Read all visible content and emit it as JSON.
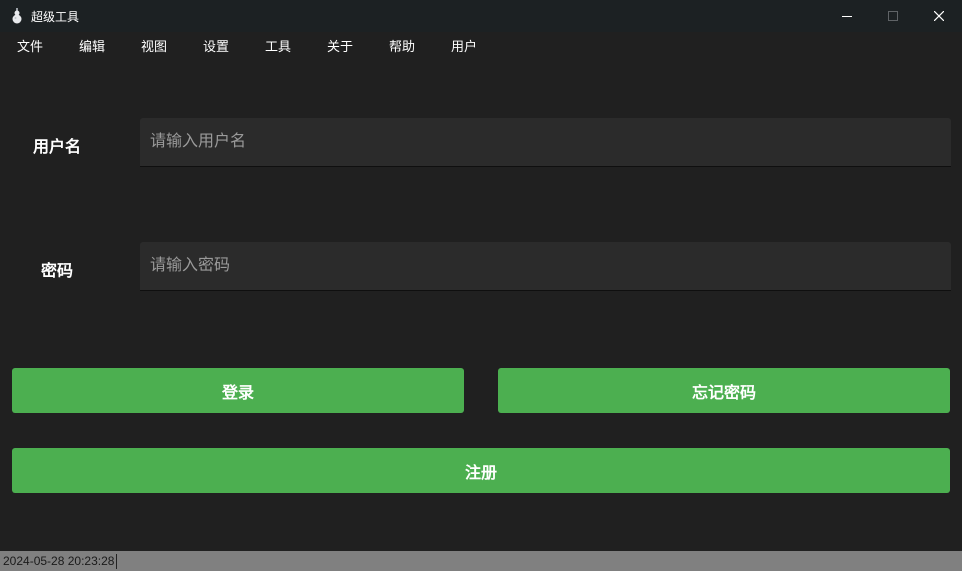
{
  "window": {
    "title": "超级工具",
    "icon": "gourd-icon"
  },
  "menu": {
    "items": [
      "文件",
      "编辑",
      "视图",
      "设置",
      "工具",
      "关于",
      "帮助",
      "用户"
    ]
  },
  "form": {
    "username": {
      "label": "用户名",
      "placeholder": "请输入用户名",
      "value": ""
    },
    "password": {
      "label": "密码",
      "placeholder": "请输入密码",
      "value": ""
    }
  },
  "buttons": {
    "login": "登录",
    "forgot_password": "忘记密码",
    "register": "注册"
  },
  "status": {
    "datetime": "2024-05-28 20:23:28"
  },
  "colors": {
    "background": "#202020",
    "titlebar": "#1c2123",
    "input_bg": "#2b2b2b",
    "accent_green": "#4caf50",
    "statusbar": "#808080"
  }
}
